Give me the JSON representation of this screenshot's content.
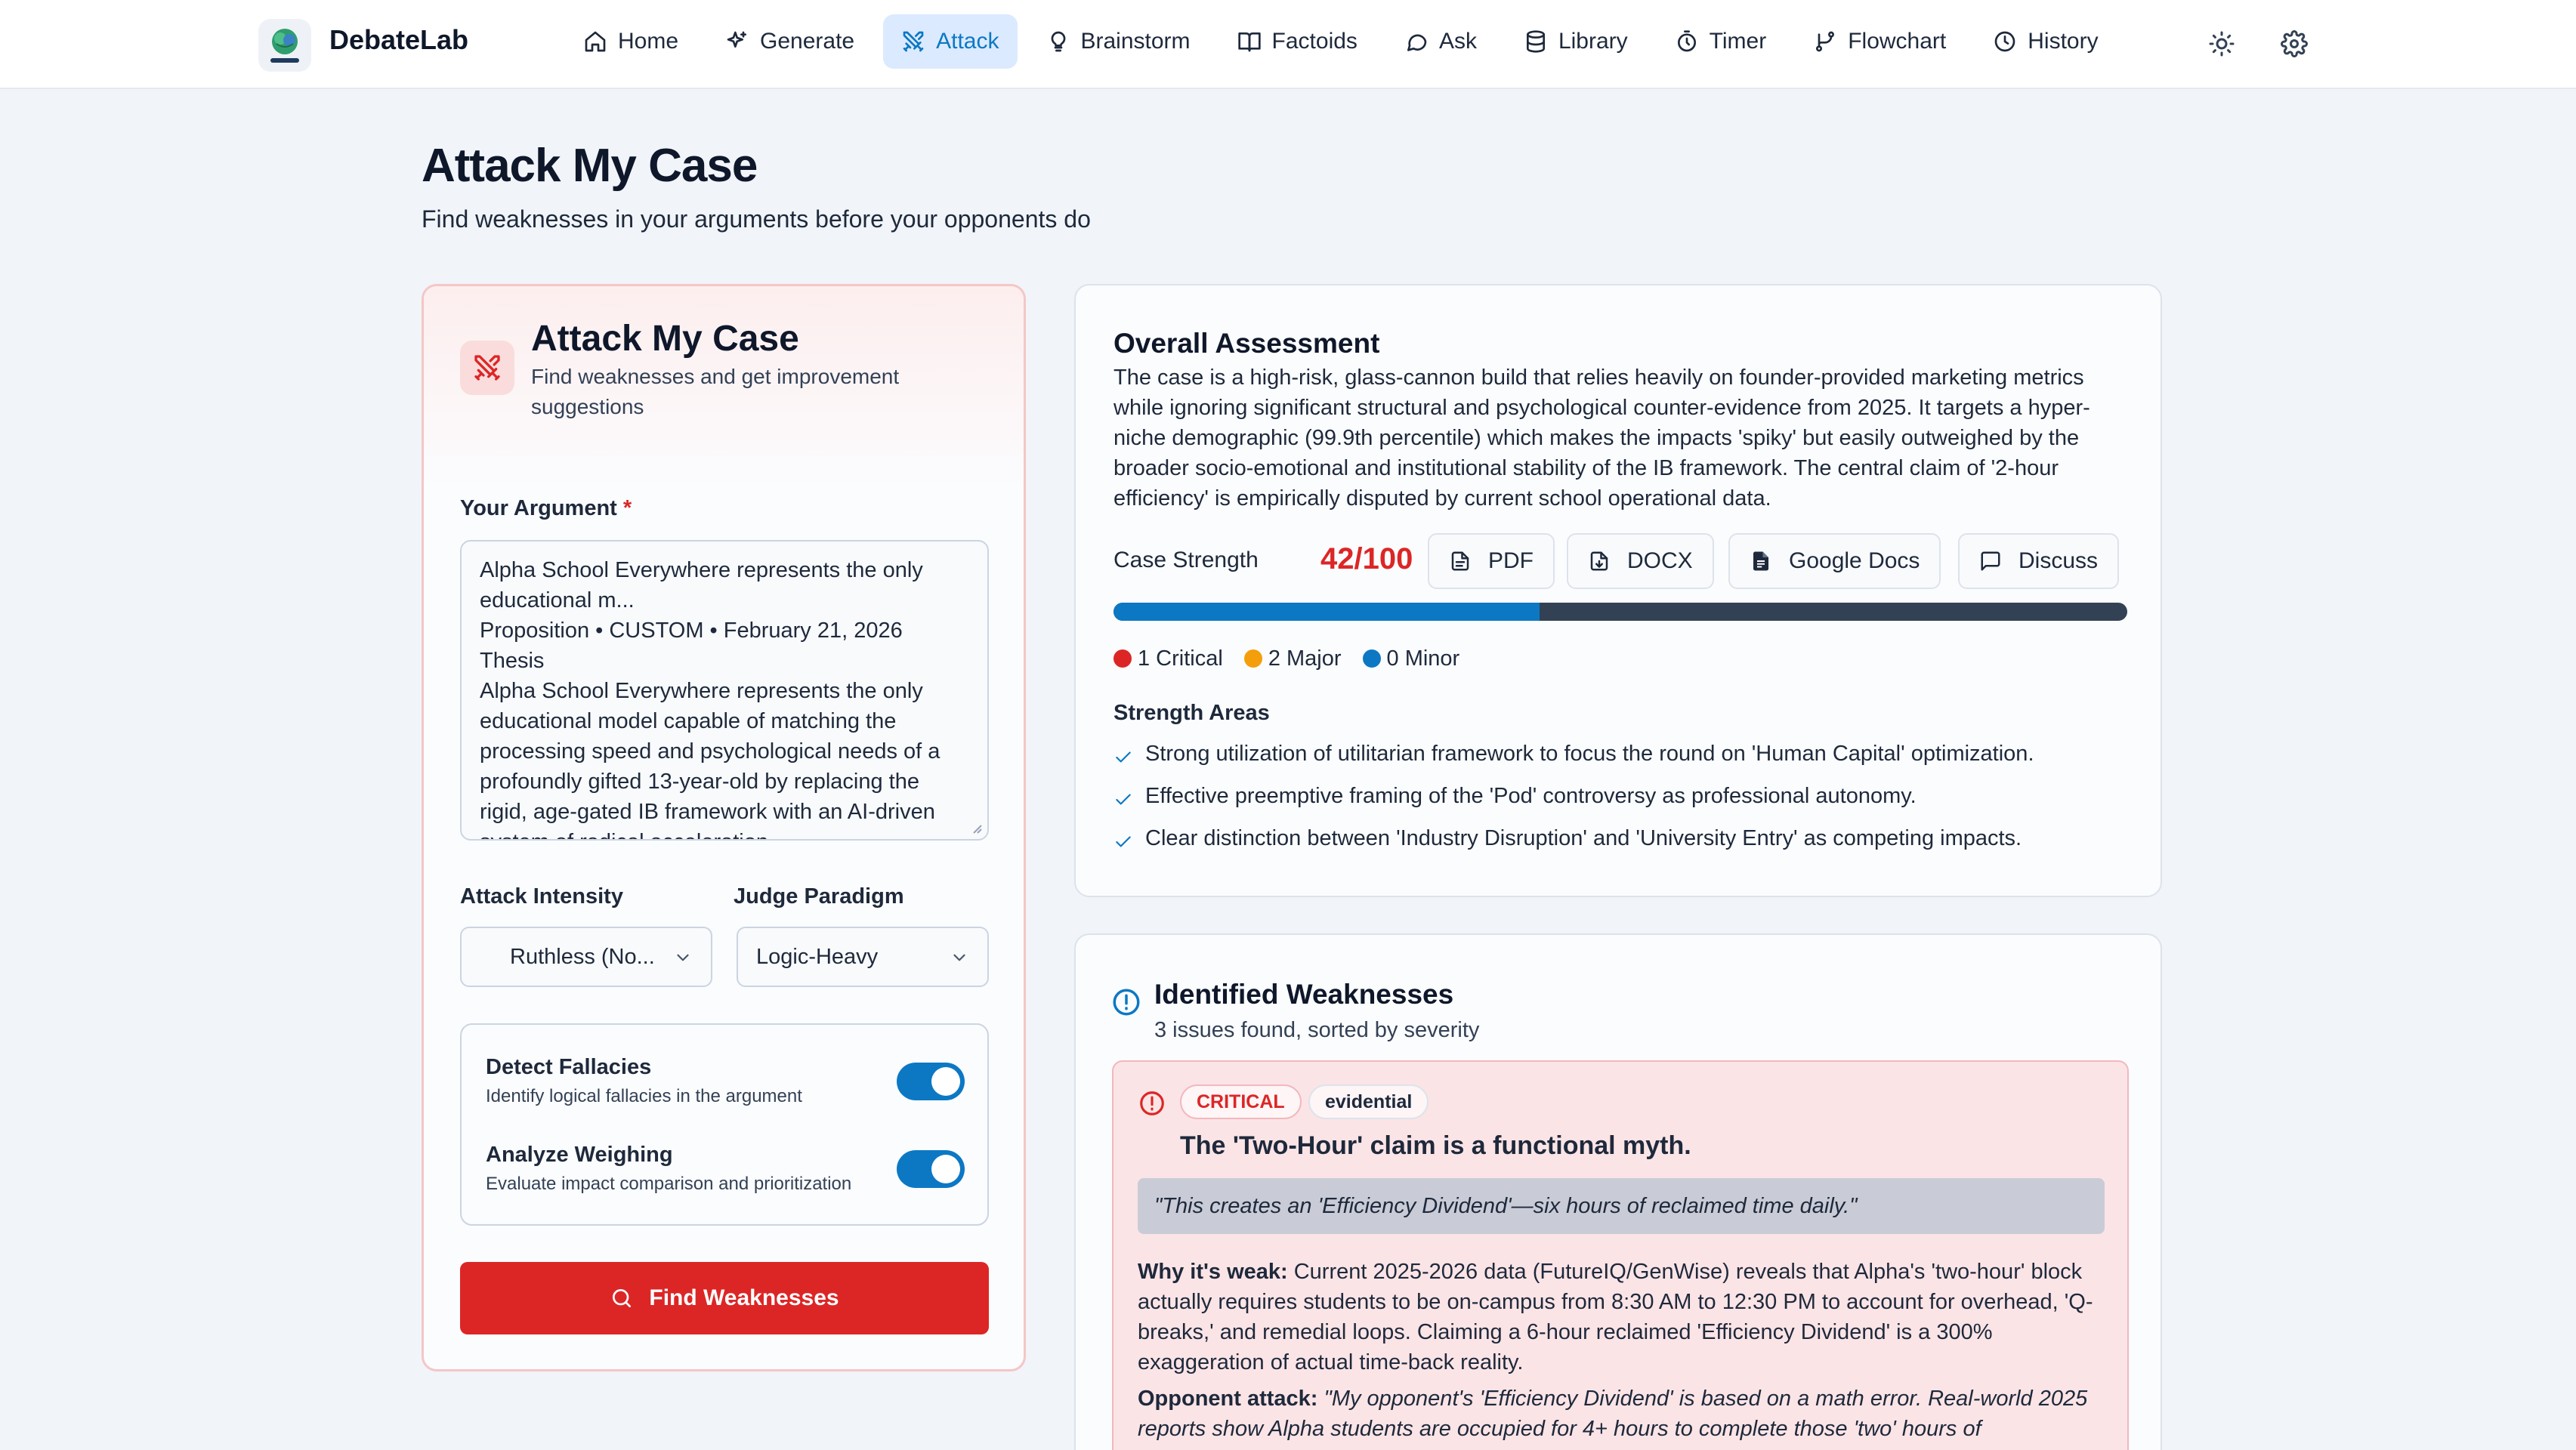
{
  "app": {
    "name": "DebateLab"
  },
  "nav": {
    "items": [
      {
        "label": "Home",
        "icon": "home-icon"
      },
      {
        "label": "Generate",
        "icon": "sparkles-icon"
      },
      {
        "label": "Attack",
        "icon": "swords-icon",
        "active": true
      },
      {
        "label": "Brainstorm",
        "icon": "lightbulb-icon"
      },
      {
        "label": "Factoids",
        "icon": "book-icon"
      },
      {
        "label": "Ask",
        "icon": "message-icon"
      },
      {
        "label": "Library",
        "icon": "database-icon"
      },
      {
        "label": "Timer",
        "icon": "timer-icon"
      },
      {
        "label": "Flowchart",
        "icon": "branch-icon"
      },
      {
        "label": "History",
        "icon": "clock-icon"
      }
    ],
    "theme_icon": "sun-icon",
    "settings_icon": "gear-icon"
  },
  "header": {
    "title": "Attack My Case",
    "subtitle": "Find weaknesses in your arguments before your opponents do"
  },
  "form": {
    "title": "Attack My Case",
    "subtitle": "Find weaknesses and get improvement suggestions",
    "argument_label": "Your Argument",
    "required_mark": "*",
    "argument_value": "Alpha School Everywhere represents the only educational m...\nProposition • CUSTOM • February 21, 2026\nThesis\nAlpha School Everywhere represents the only educational model capable of matching the processing speed and psychological needs of a profoundly gifted 13-year-old by replacing the rigid, age-gated IB framework with an AI-driven system of radical acceleration.",
    "intensity_label": "Attack Intensity",
    "intensity_value": "Ruthless (No...",
    "paradigm_label": "Judge Paradigm",
    "paradigm_value": "Logic-Heavy",
    "toggles": [
      {
        "title": "Detect Fallacies",
        "description": "Identify logical fallacies in the argument",
        "on": true
      },
      {
        "title": "Analyze Weighing",
        "description": "Evaluate impact comparison and prioritization",
        "on": true
      }
    ],
    "submit_label": "Find Weaknesses"
  },
  "assessment": {
    "title": "Overall Assessment",
    "summary": "The case is a high-risk, glass-cannon build that relies heavily on founder-provided marketing metrics while ignoring significant structural and psychological counter-evidence from 2025. It targets a hyper-niche demographic (99.9th percentile) which makes the impacts 'spiky' but easily outweighed by the broader socio-emotional and institutional stability of the IB framework. The central claim of '2-hour efficiency' is empirically disputed by current school operational data.",
    "strength_label": "Case Strength",
    "strength_score": "42/100",
    "strength_fraction": 0.42,
    "export_buttons": [
      "PDF",
      "DOCX",
      "Google Docs",
      "Discuss"
    ],
    "counts": [
      {
        "label": "1 Critical",
        "color": "#dc2626"
      },
      {
        "label": "2 Major",
        "color": "#f59e0b"
      },
      {
        "label": "0 Minor",
        "color": "#0c78c4"
      }
    ],
    "strength_areas_title": "Strength Areas",
    "strength_areas": [
      "Strong utilization of utilitarian framework to focus the round on 'Human Capital' optimization.",
      "Effective preemptive framing of the 'Pod' controversy as professional autonomy.",
      "Clear distinction between 'Industry Disruption' and 'University Entry' as competing impacts."
    ]
  },
  "weaknesses": {
    "title": "Identified Weaknesses",
    "subtitle": "3 issues found, sorted by severity",
    "items": [
      {
        "severity": "CRITICAL",
        "type": "evidential",
        "title": "The 'Two-Hour' claim is a functional myth.",
        "quote": "\"This creates an 'Efficiency Dividend'—six hours of reclaimed time daily.\"",
        "why_label": "Why it's weak:",
        "why_text": "Current 2025-2026 data (FutureIQ/GenWise) reveals that Alpha's 'two-hour' block actually requires students to be on-campus from 8:30 AM to 12:30 PM to account for overhead, 'Q-breaks,' and remedial loops. Claiming a 6-hour reclaimed 'Efficiency Dividend' is a 300% exaggeration of actual time-back reality.",
        "attack_label": "Opponent attack:",
        "attack_text": "\"My opponent's 'Efficiency Dividend' is based on a math error. Real-world 2025 reports show Alpha students are occupied for 4+ hours to complete those 'two' hours of"
      }
    ]
  },
  "colors": {
    "accent": "#0c78c4",
    "danger": "#dc2626",
    "warning": "#f59e0b",
    "background": "#f1f4f8"
  }
}
